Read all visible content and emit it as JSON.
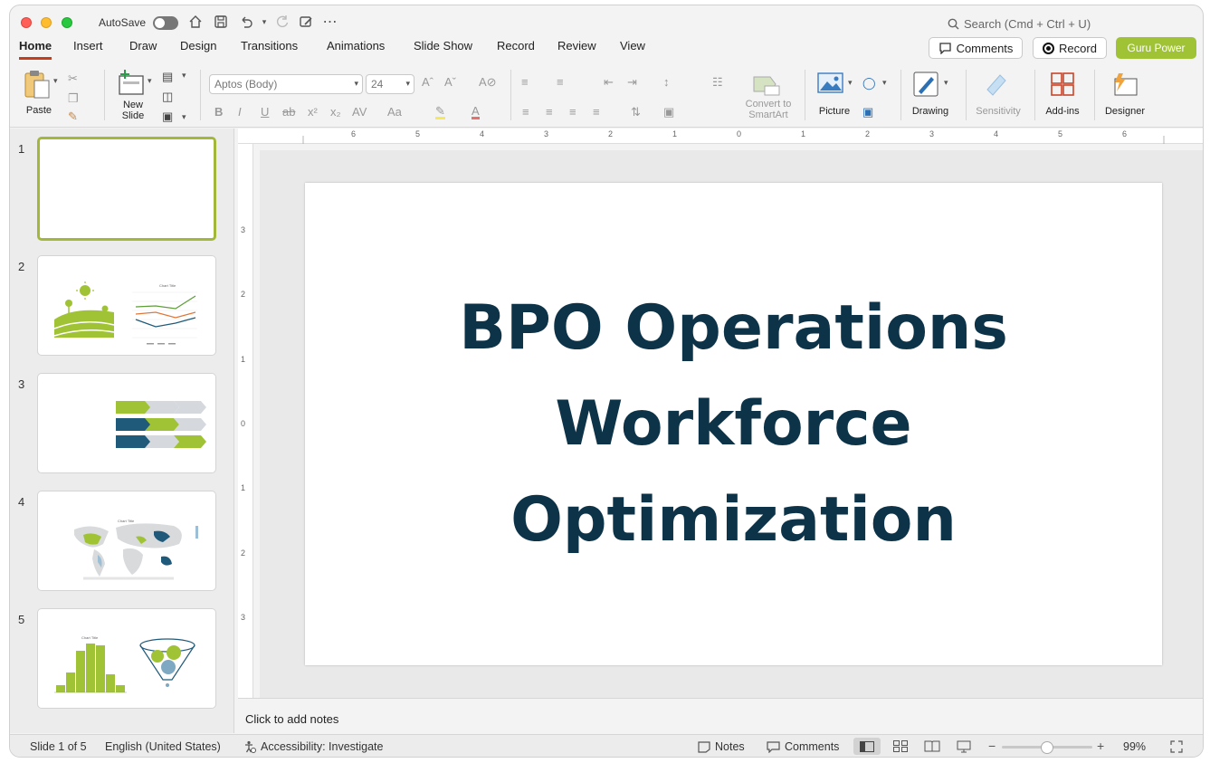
{
  "titlebar": {
    "autosave_label": "AutoSave",
    "search_placeholder": "Search (Cmd + Ctrl + U)"
  },
  "tabs": [
    "Home",
    "Insert",
    "Draw",
    "Design",
    "Transitions",
    "Animations",
    "Slide Show",
    "Record",
    "Review",
    "View"
  ],
  "active_tab": "Home",
  "actions": {
    "comments_label": "Comments",
    "record_label": "Record",
    "guru_label": "Guru Power",
    "guru_color": "#9fc334"
  },
  "ribbon": {
    "paste": "Paste",
    "new_slide": "New Slide",
    "font_name": "Aptos (Body)",
    "font_size": "24",
    "convert_smartart": "Convert to SmartArt",
    "picture": "Picture",
    "drawing": "Drawing",
    "sensitivity": "Sensitivity",
    "addins": "Add-ins",
    "designer": "Designer"
  },
  "slides": [
    {
      "number": "1",
      "selected": true
    },
    {
      "number": "2",
      "chart_title": "Chart Title"
    },
    {
      "number": "3"
    },
    {
      "number": "4",
      "chart_title": "Chart Title"
    },
    {
      "number": "5",
      "chart_title": "Chart Title"
    }
  ],
  "rulers": {
    "horizontal": [
      "6",
      "5",
      "4",
      "3",
      "2",
      "1",
      "0",
      "1",
      "2",
      "3",
      "4",
      "5",
      "6"
    ],
    "vertical": [
      "3",
      "2",
      "1",
      "0",
      "1",
      "2",
      "3"
    ]
  },
  "slide_content": {
    "title_line1": "BPO Operations",
    "title_line2": "Workforce",
    "title_line3": "Optimization",
    "title_color": "#0d3349"
  },
  "notes_placeholder": "Click to add notes",
  "statusbar": {
    "slide_position": "Slide 1 of 5",
    "language": "English (United States)",
    "accessibility": "Accessibility: Investigate",
    "notes": "Notes",
    "comments": "Comments",
    "zoom": "99%",
    "zoom_level": 0.5
  },
  "colors": {
    "accent_green": "#9fc334",
    "accent_navy": "#1f5a7a",
    "tab_underline": "#c43e1c"
  }
}
